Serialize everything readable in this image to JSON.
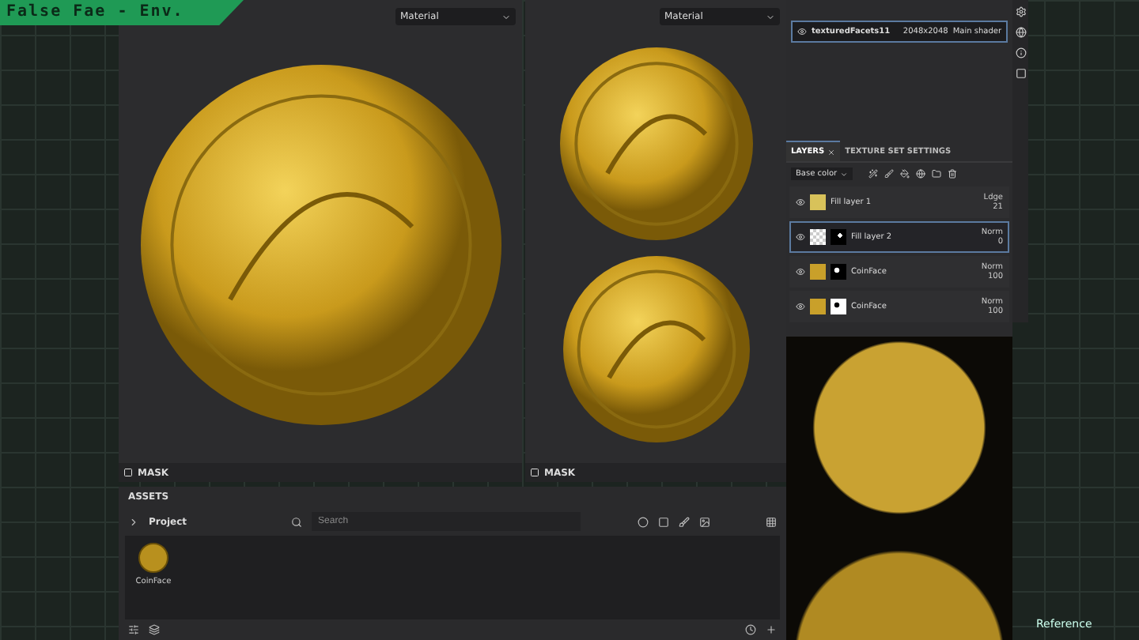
{
  "banner": {
    "title": "False Fae - Env."
  },
  "viewports": [
    {
      "dropdown": "Material",
      "footer": "MASK"
    },
    {
      "dropdown": "Material",
      "footer": "MASK"
    }
  ],
  "texture_sets": [
    {
      "name": "texturedFacets11",
      "resolution": "2048x2048",
      "shader": "Main shader",
      "selected": true
    }
  ],
  "layers_panel": {
    "tabs": [
      {
        "label": "LAYERS",
        "selected": true
      },
      {
        "label": "TEXTURE SET SETTINGS",
        "selected": false
      }
    ],
    "channel": "Base color",
    "layers": [
      {
        "name": "Fill layer 1",
        "blend": "Ldge",
        "opacity": "21",
        "selected": false,
        "kind": "fill"
      },
      {
        "name": "Fill layer 2",
        "blend": "Norm",
        "opacity": "0",
        "selected": true,
        "kind": "checker"
      },
      {
        "name": "CoinFace",
        "blend": "Norm",
        "opacity": "100",
        "selected": false,
        "kind": "dark-mask"
      },
      {
        "name": "CoinFace",
        "blend": "Norm",
        "opacity": "100",
        "selected": false,
        "kind": "light-mask"
      }
    ]
  },
  "assets": {
    "title": "ASSETS",
    "breadcrumb": "Project",
    "search": {
      "placeholder": "Search"
    },
    "items": [
      {
        "name": "CoinFace"
      }
    ]
  },
  "reference": {
    "label": "Reference"
  }
}
